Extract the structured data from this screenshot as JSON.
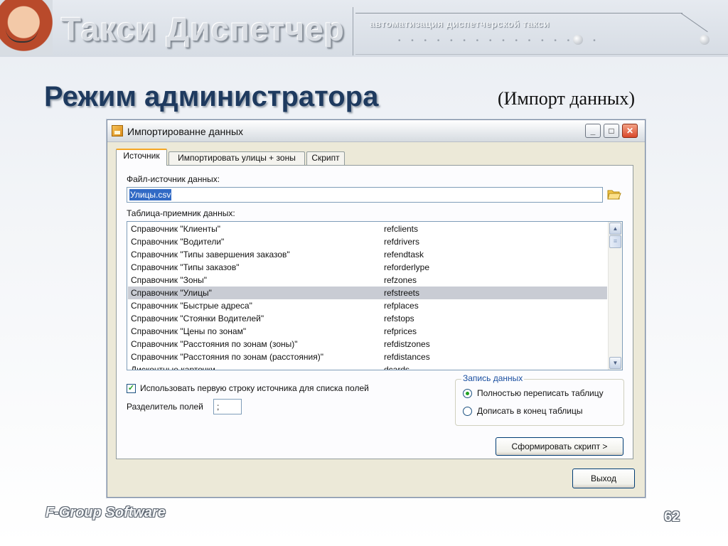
{
  "header": {
    "brand_title": "Такси Диспетчер",
    "brand_subtitle": "автоматизация диспетчерской такси"
  },
  "slide": {
    "title": "Режим администратора",
    "subtitle": "(Импорт данных)"
  },
  "window": {
    "title": "Импортированне данных",
    "tabs": [
      {
        "label": "Источник",
        "active": true
      },
      {
        "label": "Импортировать улицы + зоны",
        "active": false
      },
      {
        "label": "Скрипт",
        "active": false
      }
    ],
    "source_label": "Файл-источник данных:",
    "source_value": "Улицы.csv",
    "target_label": "Таблица-приемник данных:",
    "table_rows": [
      {
        "name": "Справочник \"Клиенты\"",
        "code": "refclients"
      },
      {
        "name": "Справочник \"Водители\"",
        "code": "refdrivers"
      },
      {
        "name": "Справочник \"Типы завершения заказов\"",
        "code": "refendtask"
      },
      {
        "name": "Справочник \"Типы заказов\"",
        "code": "reforderlype"
      },
      {
        "name": "Справочник \"Зоны\"",
        "code": "refzones"
      },
      {
        "name": "Справочник \"Улицы\"",
        "code": "refstreets",
        "selected": true
      },
      {
        "name": "Справочник \"Быстрые адреса\"",
        "code": "refplaces"
      },
      {
        "name": "Справочник \"Стоянки Водителей\"",
        "code": "refstops"
      },
      {
        "name": "Справочник \"Цены по зонам\"",
        "code": "refprices"
      },
      {
        "name": "Справочник \"Расстояния по зонам (зоны)\"",
        "code": "refdistzones"
      },
      {
        "name": "Справочник \"Расстояния по зонам (расстояния)\"",
        "code": "refdistances"
      },
      {
        "name": "Дисконтные карточки",
        "code": "dcards"
      }
    ],
    "use_first_row_label": "Использовать первую строку источника для списка полей",
    "use_first_row_checked": true,
    "separator_label": "Разделитель полей",
    "separator_value": ";",
    "write_group": {
      "legend": "Запись данных",
      "options": [
        {
          "label": "Полностью переписать таблицу",
          "selected": true
        },
        {
          "label": "Дописать в конец таблицы",
          "selected": false
        }
      ]
    },
    "build_script_button": "Сформировать скрипт  >",
    "exit_button": "Выход"
  },
  "footer": {
    "brand": "F-Group Software",
    "page_number": "62"
  }
}
